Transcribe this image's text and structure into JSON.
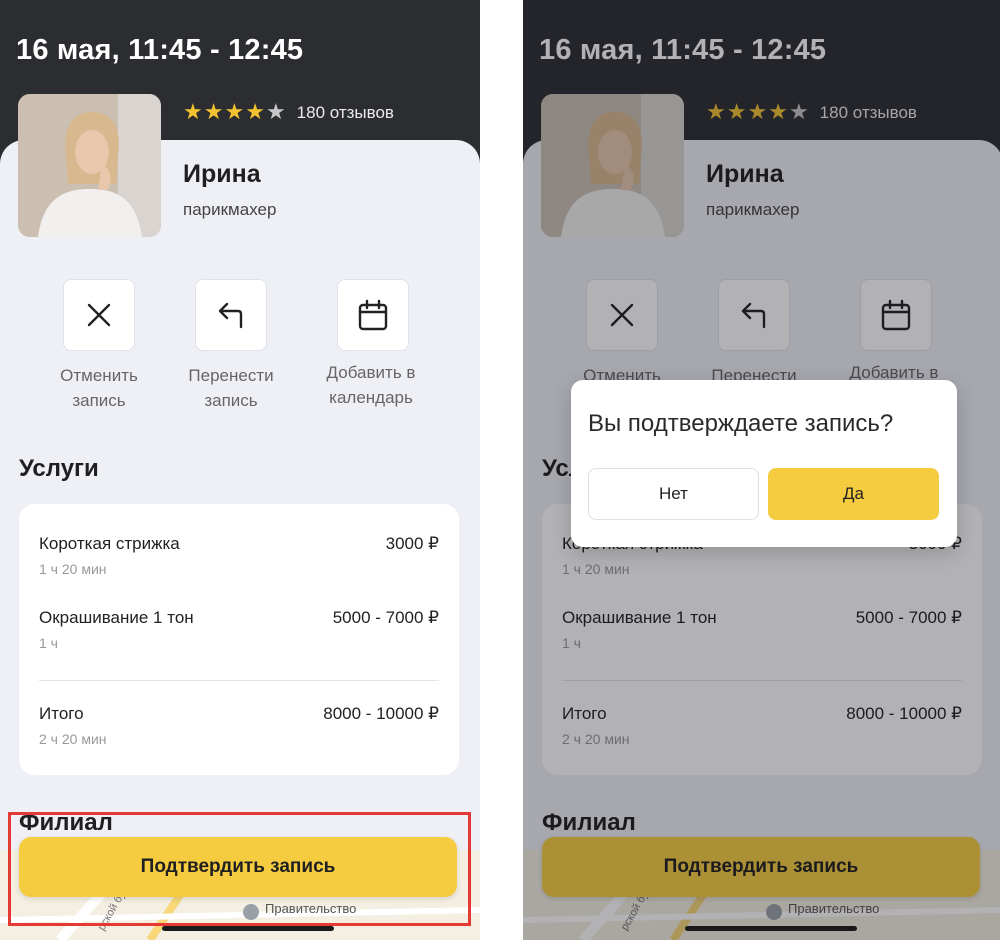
{
  "appointment": {
    "datetime": "16 мая, 11:45 - 12:45"
  },
  "master": {
    "name": "Ирина",
    "role": "парикмахер",
    "rating": 4,
    "rating_max": 5,
    "reviews": "180 отзывов"
  },
  "actions": [
    {
      "label": "Отменить\nзапись",
      "icon": "close-icon"
    },
    {
      "label": "Перенести\nзапись",
      "icon": "return-arrow-icon"
    },
    {
      "label": "Добавить в\nкалендарь",
      "icon": "calendar-icon"
    }
  ],
  "services": {
    "title": "Услуги",
    "items": [
      {
        "name": "Короткая стрижка",
        "duration": "1 ч 20 мин",
        "price": "3000 ₽"
      },
      {
        "name": "Окрашивание 1 тон",
        "duration": "1 ч",
        "price": "5000 - 7000 ₽"
      }
    ],
    "total": {
      "name": "Итого",
      "duration": "2 ч 20 мин",
      "price": "8000 - 10000 ₽"
    }
  },
  "branch": {
    "title": "Филиал",
    "map_label": "Правительство",
    "map_street_fragment": "рской бу"
  },
  "confirm_button": "Подтвердить запись",
  "dialog": {
    "question": "Вы подтверждаете запись?",
    "no": "Нет",
    "yes": "Да"
  },
  "colors": {
    "accent": "#f5cc40",
    "header": "#2b2d31",
    "background": "#eef0f5",
    "star": "#f2c230",
    "star_empty": "#c7c7c7",
    "highlight": "#e53935"
  }
}
